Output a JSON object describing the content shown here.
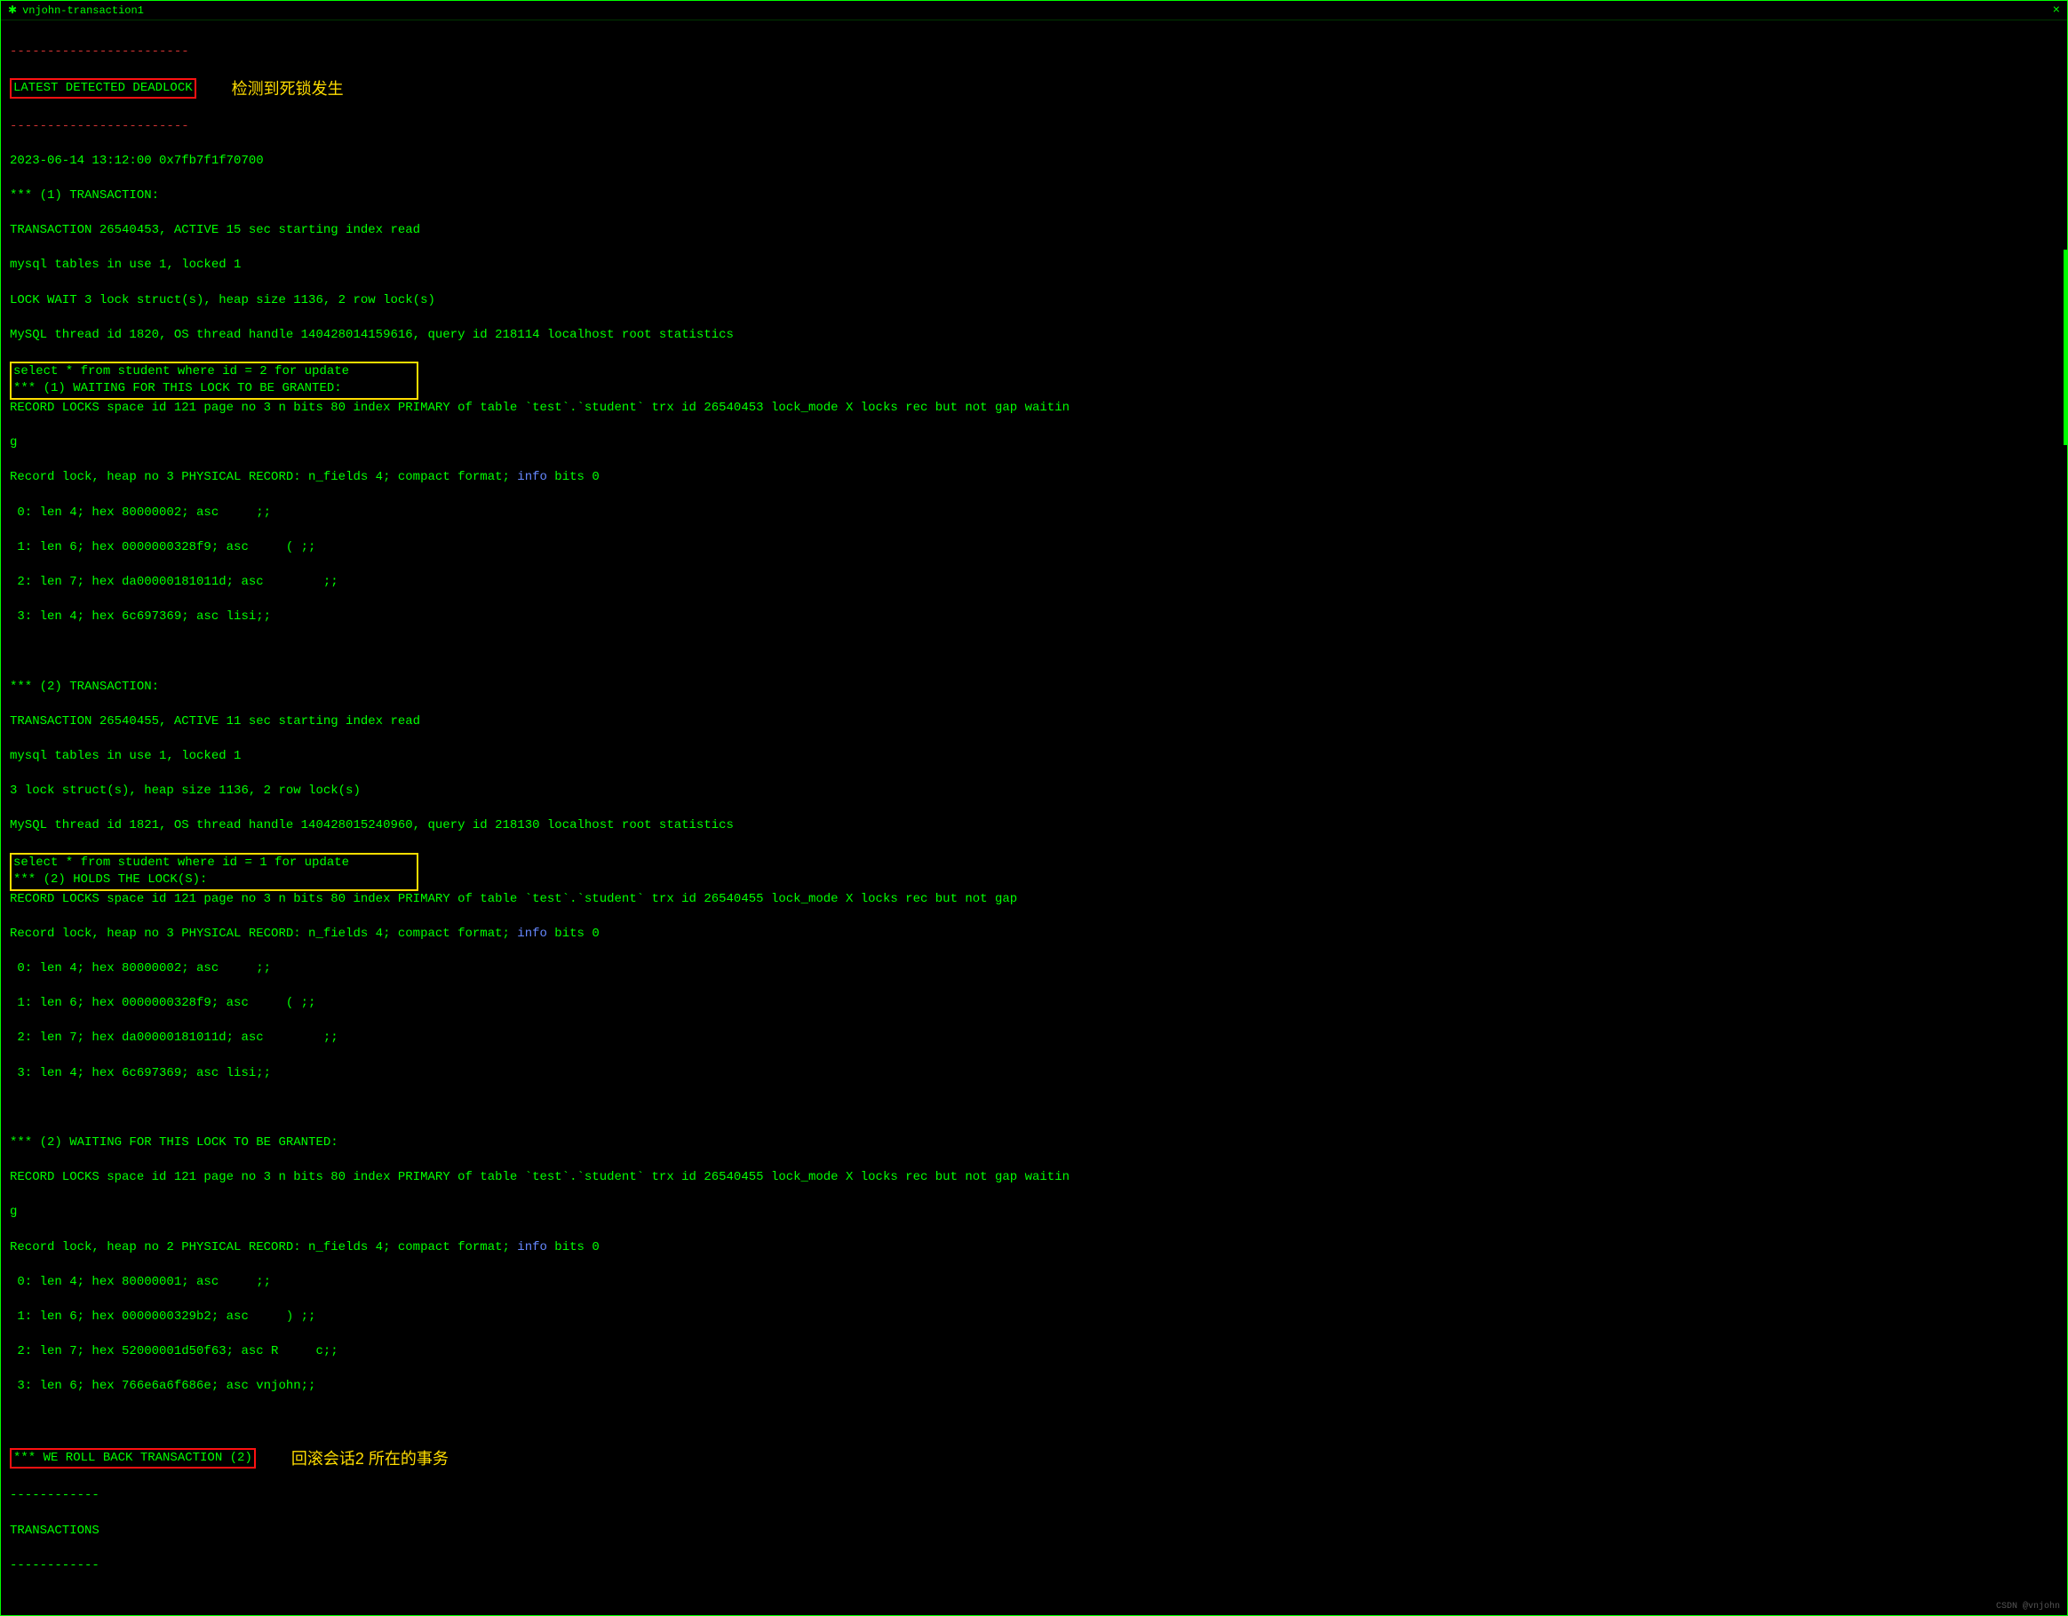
{
  "titlebar": {
    "title": "vnjohn-transaction1"
  },
  "annotations": {
    "deadlock_detected": "检测到死锁发生",
    "rollback_session2": "回滚会话2 所在的事务"
  },
  "header": {
    "latest_deadlock": "LATEST DETECTED DEADLOCK",
    "dashes": "------------------------",
    "timestamp": "2023-06-14 13:12:00 0x7fb7f1f70700"
  },
  "txn1": {
    "header": "*** (1) TRANSACTION:",
    "info_line": "TRANSACTION 26540453, ACTIVE 15 sec starting index read",
    "tables": "mysql tables in use 1, locked 1",
    "lock_wait": "LOCK WAIT 3 lock struct(s), heap size 1136, 2 row lock(s)",
    "thread": "MySQL thread id 1820, OS thread handle 140428014159616, query id 218114 localhost root statistics",
    "sql": "select * from student where id = 2 for update",
    "waiting": "*** (1) WAITING FOR THIS LOCK TO BE GRANTED:",
    "record_locks_a": "RECORD LOCKS space id 121 page no 3 n bits 80 index PRIMARY of table `test`.`student` trx id 26540453 lock_mode X locks rec but not gap waitin",
    "record_locks_b": "g",
    "record_lock_heap_a": "Record lock, heap no 3 PHYSICAL RECORD: n_fields 4; compact format; ",
    "record_lock_heap_b": "info",
    "record_lock_heap_c": " bits 0",
    "f0": " 0: len 4; hex 80000002; asc     ;;",
    "f1": " 1: len 6; hex 0000000328f9; asc     ( ;;",
    "f2": " 2: len 7; hex da00000181011d; asc        ;;",
    "f3": " 3: len 4; hex 6c697369; asc lisi;;"
  },
  "txn2": {
    "header": "*** (2) TRANSACTION:",
    "info_line": "TRANSACTION 26540455, ACTIVE 11 sec starting index read",
    "tables": "mysql tables in use 1, locked 1",
    "lock_struct": "3 lock struct(s), heap size 1136, 2 row lock(s)",
    "thread": "MySQL thread id 1821, OS thread handle 140428015240960, query id 218130 localhost root statistics",
    "sql": "select * from student where id = 1 for update",
    "holds": "*** (2) HOLDS THE LOCK(S):",
    "record_locks": "RECORD LOCKS space id 121 page no 3 n bits 80 index PRIMARY of table `test`.`student` trx id 26540455 lock_mode X locks rec but not gap",
    "record_lock_heap_a": "Record lock, heap no 3 PHYSICAL RECORD: n_fields 4; compact format; ",
    "record_lock_heap_b": "info",
    "record_lock_heap_c": " bits 0",
    "f0": " 0: len 4; hex 80000002; asc     ;;",
    "f1": " 1: len 6; hex 0000000328f9; asc     ( ;;",
    "f2": " 2: len 7; hex da00000181011d; asc        ;;",
    "f3": " 3: len 4; hex 6c697369; asc lisi;;",
    "waiting_header": "*** (2) WAITING FOR THIS LOCK TO BE GRANTED:",
    "wait_record_locks_a": "RECORD LOCKS space id 121 page no 3 n bits 80 index PRIMARY of table `test`.`student` trx id 26540455 lock_mode X locks rec but not gap waitin",
    "wait_record_locks_b": "g",
    "wait_record_lock_heap_a": "Record lock, heap no 2 PHYSICAL RECORD: n_fields 4; compact format; ",
    "wait_record_lock_heap_b": "info",
    "wait_record_lock_heap_c": " bits 0",
    "w0": " 0: len 4; hex 80000001; asc     ;;",
    "w1": " 1: len 6; hex 0000000329b2; asc     ) ;;",
    "w2": " 2: len 7; hex 52000001d50f63; asc R     c;;",
    "w3": " 3: len 6; hex 766e6a6f686e; asc vnjohn;;"
  },
  "footer": {
    "rollback": "*** WE ROLL BACK TRANSACTION (2)",
    "dashes1": "------------",
    "transactions": "TRANSACTIONS",
    "dashes2": "------------"
  },
  "watermark": "CSDN @vnjohn"
}
